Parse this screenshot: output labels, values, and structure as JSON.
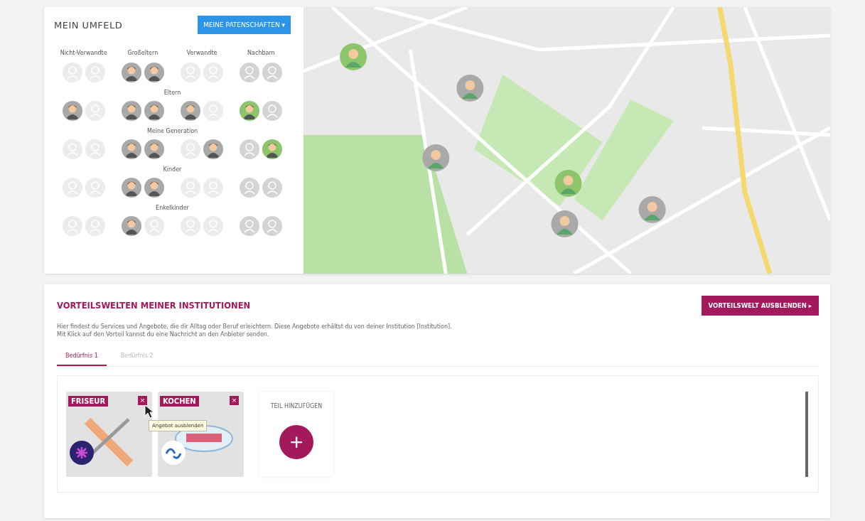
{
  "umfeld": {
    "title": "MEIN UMFELD",
    "button": "MEINE PATENSCHAFTEN ▾",
    "columns": [
      "Nicht-Verwandte",
      "Großeltern",
      "Verwandte",
      "Nachbarn"
    ],
    "rows": [
      {
        "cells": [
          [
            {
              "filled": false,
              "color": "#ececec"
            },
            {
              "filled": false,
              "color": "#ececec"
            }
          ],
          [
            {
              "filled": true,
              "color": "#a9a9a9"
            },
            {
              "filled": true,
              "color": "#a9a9a9"
            }
          ],
          [
            {
              "filled": false,
              "color": "#ececec"
            },
            {
              "filled": false,
              "color": "#ececec"
            }
          ],
          [
            {
              "filled": false,
              "color": "#d4d4d4"
            },
            {
              "filled": false,
              "color": "#d4d4d4"
            }
          ]
        ]
      },
      {
        "label": "Eltern",
        "cells": [
          [
            {
              "filled": true,
              "color": "#a9a9a9"
            },
            {
              "filled": false,
              "color": "#ececec"
            }
          ],
          [
            {
              "filled": true,
              "color": "#a9a9a9"
            },
            {
              "filled": true,
              "color": "#a9a9a9"
            }
          ],
          [
            {
              "filled": true,
              "color": "#a9a9a9"
            },
            {
              "filled": false,
              "color": "#ececec"
            }
          ],
          [
            {
              "filled": true,
              "color": "#8cc56a"
            },
            {
              "filled": false,
              "color": "#d4d4d4"
            }
          ]
        ]
      },
      {
        "label": "Meine Generation",
        "cells": [
          [
            {
              "filled": false,
              "color": "#ececec"
            },
            {
              "filled": false,
              "color": "#ececec"
            }
          ],
          [
            {
              "filled": true,
              "color": "#a9a9a9"
            },
            {
              "filled": true,
              "color": "#a9a9a9"
            }
          ],
          [
            {
              "filled": false,
              "color": "#ececec"
            },
            {
              "filled": true,
              "color": "#a9a9a9"
            }
          ],
          [
            {
              "filled": false,
              "color": "#d4d4d4"
            },
            {
              "filled": true,
              "color": "#8cc56a"
            }
          ]
        ]
      },
      {
        "label": "Kinder",
        "cells": [
          [
            {
              "filled": false,
              "color": "#ececec"
            },
            {
              "filled": false,
              "color": "#ececec"
            }
          ],
          [
            {
              "filled": true,
              "color": "#a9a9a9"
            },
            {
              "filled": true,
              "color": "#a9a9a9"
            }
          ],
          [
            {
              "filled": false,
              "color": "#ececec"
            },
            {
              "filled": false,
              "color": "#ececec"
            }
          ],
          [
            {
              "filled": false,
              "color": "#d4d4d4"
            },
            {
              "filled": false,
              "color": "#d4d4d4"
            }
          ]
        ]
      },
      {
        "label": "Enkelkinder",
        "cells": [
          [
            {
              "filled": false,
              "color": "#ececec"
            },
            {
              "filled": false,
              "color": "#ececec"
            }
          ],
          [
            {
              "filled": true,
              "color": "#a9a9a9"
            },
            {
              "filled": false,
              "color": "#ececec"
            }
          ],
          [
            {
              "filled": false,
              "color": "#ececec"
            },
            {
              "filled": false,
              "color": "#ececec"
            }
          ],
          [
            {
              "filled": false,
              "color": "#d4d4d4"
            },
            {
              "filled": false,
              "color": "#d4d4d4"
            }
          ]
        ]
      }
    ]
  },
  "vorteile": {
    "title": "VORTEILSWELTEN MEINER INSTITUTIONEN",
    "button": "VORTEILSWELT AUSBLENDEN ▸",
    "description": [
      "Hier findest du Services und Angebote, die dir Alltag oder Beruf erleichtern. Diese Angebote erhältst du von deiner Institution [Institution].",
      "Mit Klick auf den Vorteil kannst du eine Nachricht an den Anbieter senden."
    ],
    "tabs": [
      {
        "label": "Bedürfnis 1",
        "selected": true
      },
      {
        "label": "Bedürfnis 2",
        "selected": false
      }
    ],
    "cards": [
      {
        "label": "FRISEUR",
        "kind": "friseur",
        "close": "×",
        "tooltip": "Angebot ausblenden"
      },
      {
        "label": "KOCHEN",
        "kind": "kochen",
        "close": "×"
      }
    ],
    "add": {
      "label": "TEIL HINZUFÜGEN",
      "icon": "+"
    }
  }
}
